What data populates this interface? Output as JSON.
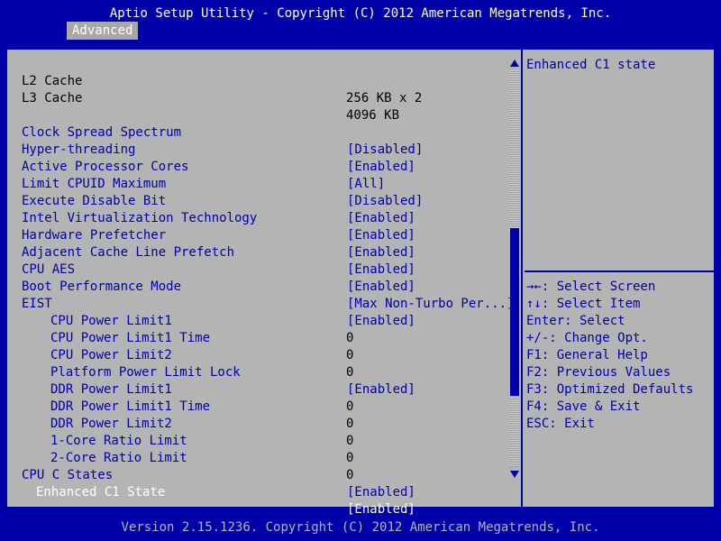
{
  "header": {
    "title": "Aptio Setup Utility - Copyright (C) 2012 American Megatrends, Inc.",
    "active_tab": "Advanced"
  },
  "settings": {
    "l2_cache": {
      "label": "L2 Cache",
      "value": "256 KB x 2"
    },
    "l3_cache": {
      "label": "L3 Cache",
      "value": "4096 KB"
    },
    "clock_spread": {
      "label": "Clock Spread Spectrum",
      "value": "[Disabled]"
    },
    "hyper_threading": {
      "label": "Hyper-threading",
      "value": "[Enabled]"
    },
    "active_cores": {
      "label": "Active Processor Cores",
      "value": "[All]"
    },
    "limit_cpuid": {
      "label": "Limit CPUID Maximum",
      "value": "[Disabled]"
    },
    "execute_disable": {
      "label": "Execute Disable Bit",
      "value": "[Enabled]"
    },
    "intel_vt": {
      "label": "Intel Virtualization Technology",
      "value": "[Enabled]"
    },
    "hw_prefetcher": {
      "label": "Hardware Prefetcher",
      "value": "[Enabled]"
    },
    "adj_prefetch": {
      "label": "Adjacent Cache Line Prefetch",
      "value": "[Enabled]"
    },
    "cpu_aes": {
      "label": "CPU AES",
      "value": "[Enabled]"
    },
    "boot_perf": {
      "label": "Boot Performance Mode",
      "value": "[Max Non-Turbo Per...]"
    },
    "eist": {
      "label": "EIST",
      "value": "[Enabled]"
    },
    "cpu_pl1": {
      "label": "CPU Power Limit1",
      "value": "0"
    },
    "cpu_pl1_time": {
      "label": "CPU Power Limit1 Time",
      "value": "0"
    },
    "cpu_pl2": {
      "label": "CPU Power Limit2",
      "value": "0"
    },
    "platform_pl_lock": {
      "label": "Platform Power Limit Lock",
      "value": "[Enabled]"
    },
    "ddr_pl1": {
      "label": "DDR Power Limit1",
      "value": "0"
    },
    "ddr_pl1_time": {
      "label": "DDR Power Limit1 Time",
      "value": "0"
    },
    "ddr_pl2": {
      "label": "DDR Power Limit2",
      "value": "0"
    },
    "ratio_1core": {
      "label": "1-Core Ratio Limit",
      "value": "0"
    },
    "ratio_2core": {
      "label": "2-Core Ratio Limit",
      "value": "0"
    },
    "cpu_c_states": {
      "label": "CPU C States",
      "value": "[Enabled]"
    },
    "enhanced_c1": {
      "label": "Enhanced C1 State",
      "value": "[Enabled]"
    }
  },
  "help": {
    "description": "Enhanced C1 state",
    "keys": {
      "select_screen": "→←: Select Screen",
      "select_item": "↑↓: Select Item",
      "enter": "Enter: Select",
      "change_opt": "+/-: Change Opt.",
      "general_help": "F1: General Help",
      "previous_values": "F2: Previous Values",
      "optimized_defaults": "F3: Optimized Defaults",
      "save_exit": "F4: Save & Exit",
      "esc_exit": "ESC: Exit"
    }
  },
  "footer": {
    "text": "Version 2.15.1236. Copyright (C) 2012 American Megatrends, Inc."
  },
  "scrollbar": {
    "position_fraction": 0.4,
    "visible_fraction": 0.42
  },
  "colors": {
    "background": "#0000a8",
    "panel": "#b4b4b4",
    "option_text": "#0000a8",
    "info_text": "#000000",
    "selected_text": "#ffffff"
  }
}
